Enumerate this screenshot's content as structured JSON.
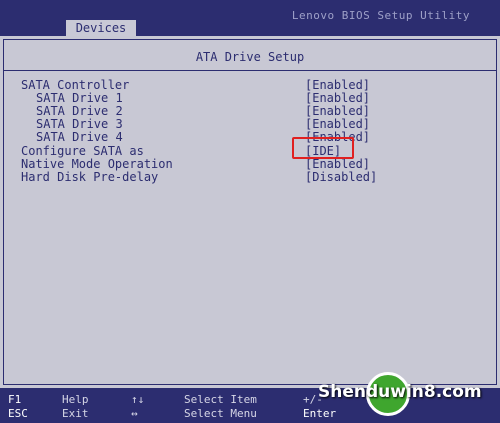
{
  "header": {
    "tab_label": "Devices",
    "brand": "Lenovo BIOS Setup Utility"
  },
  "panel": {
    "title": "ATA Drive Setup",
    "settings": [
      {
        "label": "SATA Controller",
        "value": "[Enabled]"
      },
      {
        "label": "SATA Drive 1",
        "value": "[Enabled]"
      },
      {
        "label": "SATA Drive 2",
        "value": "[Enabled]"
      },
      {
        "label": "SATA Drive 3",
        "value": "[Enabled]"
      },
      {
        "label": "SATA Drive 4",
        "value": "[Enabled]"
      },
      {
        "label": "Configure SATA as",
        "value": "[IDE]"
      },
      {
        "label": "Native Mode Operation",
        "value": "[Enabled]"
      },
      {
        "label": "Hard Disk Pre-delay",
        "value": "[Disabled]"
      }
    ]
  },
  "statusbar": {
    "f1_key": "F1",
    "f1_action": "Help",
    "esc_key": "ESC",
    "esc_action": "Exit",
    "updown_symbol": "↑↓",
    "updown_action": "Select Item",
    "leftright_symbol": "↔",
    "leftright_action": "Select Menu",
    "plusminus_symbol": "+/-",
    "enter_key": "Enter"
  },
  "watermark": {
    "brand": "Shenduwin8.com"
  },
  "colors": {
    "background": "#2c2d70",
    "panel": "#c8c8d4",
    "text": "#2c2d70",
    "highlight": "#e02020"
  }
}
